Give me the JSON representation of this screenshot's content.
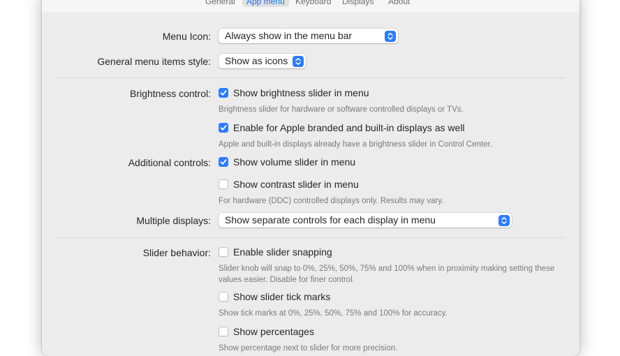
{
  "tabs": [
    "General",
    "App menu",
    "Keyboard",
    "Displays",
    "About"
  ],
  "active_tab": "App menu",
  "accent_color": "#2f7cf6",
  "menu_icon": {
    "label": "Menu Icon:",
    "value": "Always show in the menu bar"
  },
  "menu_style": {
    "label": "General menu items style:",
    "value": "Show as icons"
  },
  "brightness": {
    "label": "Brightness control:",
    "option1": {
      "text": "Show brightness slider in menu",
      "checked": true
    },
    "note1": "Brightness slider for hardware or software controlled displays or TVs.",
    "option2": {
      "text": "Enable for Apple branded and built-in displays as well",
      "checked": true
    },
    "note2": "Apple and built-in displays already have a brightness slider in Control Center."
  },
  "additional": {
    "label": "Additional controls:",
    "option1": {
      "text": "Show volume slider in menu",
      "checked": true
    },
    "option2": {
      "text": "Show contrast slider in menu",
      "checked": false
    },
    "note": "For hardware (DDC) controlled displays only. Results may vary."
  },
  "multiple": {
    "label": "Multiple displays:",
    "value": "Show separate controls for each display in menu"
  },
  "slider": {
    "label": "Slider behavior:",
    "option1": {
      "text": "Enable slider snapping",
      "checked": false
    },
    "note1": "Slider knob will snap to 0%, 25%, 50%, 75% and 100% when in proximity making setting these values easier. Disable for finer control.",
    "option2": {
      "text": "Show slider tick marks",
      "checked": false
    },
    "note2": "Show tick marks at 0%, 25%, 50%, 75% and 100% for accuracy.",
    "option3": {
      "text": "Show percentages",
      "checked": false
    },
    "note3": "Show percentage next to slider for more precision."
  }
}
